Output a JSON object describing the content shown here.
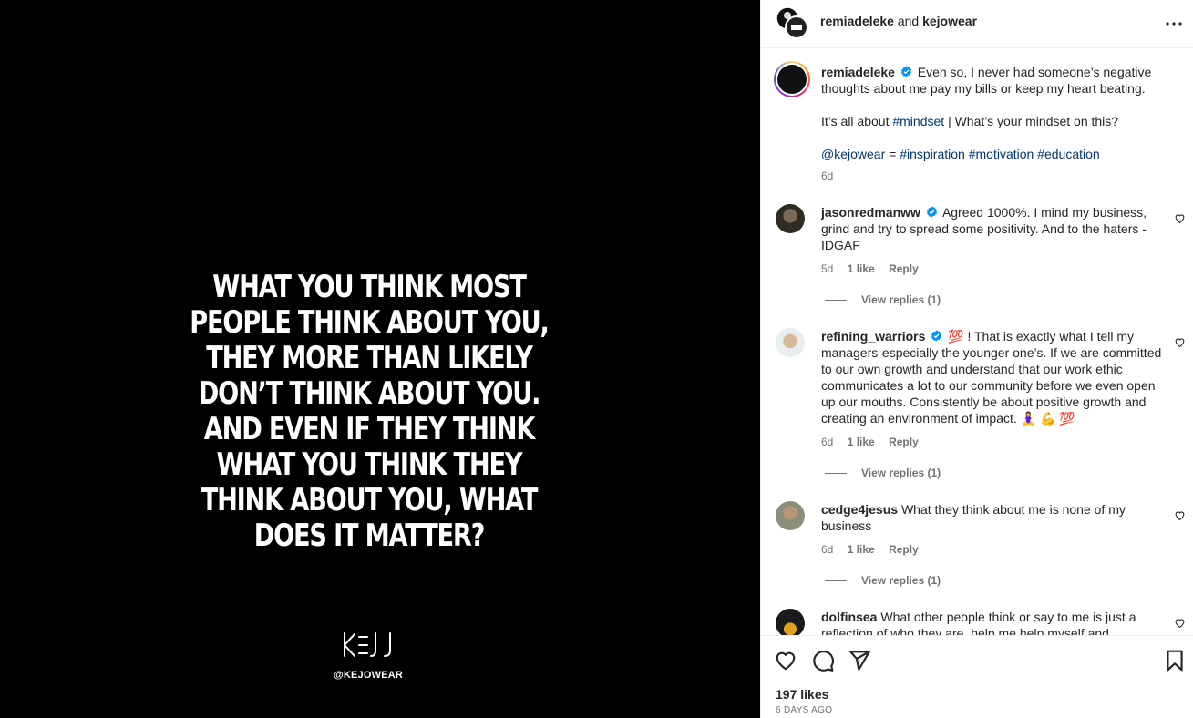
{
  "post": {
    "quote": "WHAT YOU THINK MOST PEOPLE THINK ABOUT YOU, THEY MORE THAN LIKELY DON’T THINK ABOUT YOU. AND EVEN IF THEY THINK WHAT YOU THINK THEY THINK ABOUT YOU, WHAT DOES IT MATTER?",
    "brand_logo_text": "KEJU",
    "brand_handle": "@KEJOWEAR"
  },
  "header": {
    "user1": "remiadeleke",
    "and": "and",
    "user2": "kejowear"
  },
  "caption": {
    "username": "remiadeleke",
    "line1": "Even so, I never had someone’s negative thoughts about me pay my bills or keep my heart beating.",
    "line2_pre": "It’s all about",
    "line2_tag": "#mindset",
    "line2_post": "| What’s your mindset on this?",
    "mention": "@kejowear",
    "eq": "=",
    "tag1": "#inspiration",
    "tag2": "#motivation",
    "tag3": "#education",
    "time": "6d"
  },
  "comments": [
    {
      "username": "jasonredmanww",
      "text": "Agreed 1000%. I mind my business, grind and try to spread some positivity. And to the haters - IDGAF",
      "time": "5d",
      "likes": "1 like",
      "reply": "Reply",
      "view_replies": "View replies (1)"
    },
    {
      "username": "refining_warriors",
      "text": "💯 ! That is exactly what I tell my managers-especially the younger one’s. If we are committed to our own growth and understand that our work ethic communicates a lot to our community before we even open up our mouths. Consistently be about positive growth and creating an environment of impact. 🧘‍♀️ 💪 💯",
      "time": "6d",
      "likes": "1 like",
      "reply": "Reply",
      "view_replies": "View replies (1)"
    },
    {
      "username": "cedge4jesus",
      "text": "What they think about me is none of my business",
      "time": "6d",
      "likes": "1 like",
      "reply": "Reply",
      "view_replies": "View replies (1)"
    },
    {
      "username": "dolfinsea",
      "text": "What other people think or say to me is just a reflection of who they are, help me help myself and understand"
    }
  ],
  "footer": {
    "likes": "197 likes",
    "time_ago": "6 DAYS AGO"
  },
  "colors": {
    "hashtag": "#00376b",
    "verified": "#0095f6",
    "muted": "#737373"
  }
}
